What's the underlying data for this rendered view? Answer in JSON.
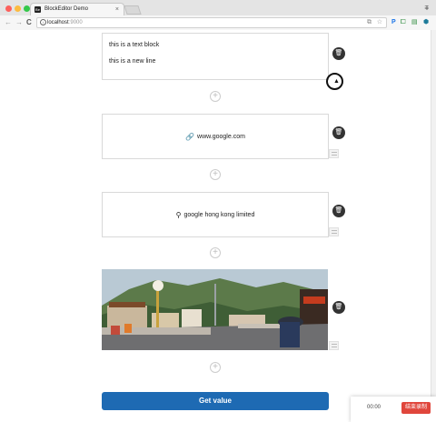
{
  "browser": {
    "tab_title": "BlockEditor Demo",
    "tab_favicon_text": "Be",
    "tab_close": "×",
    "window_button": "⩨",
    "nav_back": "←",
    "nav_forward": "→",
    "nav_reload": "C",
    "url_host": "localhost",
    "url_port": ":9000",
    "info_icon": "i",
    "icons": [
      "translate-icon",
      "star-icon",
      "p-icon",
      "puzzle-icon",
      "bookmark-icon",
      "shield-icon"
    ]
  },
  "editor": {
    "text_block": {
      "lines": [
        "this is a text block",
        "this is a new line"
      ]
    },
    "link_block": {
      "text": "www.google.com",
      "icon": "link-icon"
    },
    "location_block": {
      "text": "google hong kong limited",
      "icon": "map-pin-icon"
    },
    "image_block": {
      "alt": "photo-of-a-street-with-mountains"
    },
    "add_label": "+",
    "delete_icon": "trash-icon",
    "drag_icon": "drag-handle-icon"
  },
  "footer": {
    "button_label": "Get value"
  },
  "recorder": {
    "time": "00:00",
    "stop_label": "结束录制"
  }
}
